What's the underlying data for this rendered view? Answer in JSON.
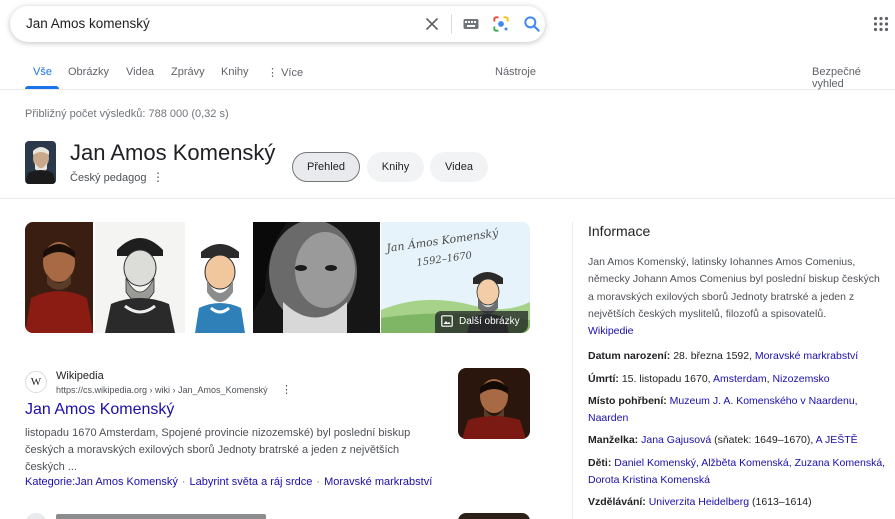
{
  "search": {
    "query": "Jan Amos komenský"
  },
  "tabs": {
    "items": [
      {
        "label": "Vše",
        "active": true
      },
      {
        "label": "Obrázky",
        "active": false
      },
      {
        "label": "Videa",
        "active": false
      },
      {
        "label": "Zprávy",
        "active": false
      },
      {
        "label": "Knihy",
        "active": false
      },
      {
        "label": "Více",
        "active": false
      }
    ],
    "tools": "Nástroje",
    "safesearch": "Bezpečné vyhled"
  },
  "stats": "Přibližný počet výsledků: 788 000 (0,32 s)",
  "entity": {
    "title": "Jan Amos Komenský",
    "subtitle": "Český pedagog",
    "chips": [
      "Přehled",
      "Knihy",
      "Videa"
    ]
  },
  "images": {
    "more_label": "Další obrázky",
    "handwritten": "Jan Ámos Komenský 1592–1670"
  },
  "result": {
    "favicon_letter": "W",
    "site_name": "Wikipedia",
    "url": "https://cs.wikipedia.org › wiki › Jan_Amos_Komenský",
    "title": "Jan Amos Komenský",
    "snippet_1": "listopadu 1670 Amsterdam, Spojené provincie nizozemské) byl poslední biskup",
    "snippet_2": "českých a moravských exilových sborů Jednoty bratrské a jeden z největších",
    "snippet_3": "českých ...",
    "links": [
      "Kategorie:Jan Amos Komenský",
      "Labyrint světa a ráj srdce",
      "Moravské markrabství"
    ]
  },
  "knowledge_panel": {
    "title": "Informace",
    "description": "Jan Amos Komenský, latinsky Iohannes Amos Comenius, německy Johann Amos Comenius byl poslední biskup českých a moravských exilových sborů Jednoty bratrské a jeden z největších českých myslitelů, filozofů a spisovatelů.",
    "source": "Wikipedie",
    "facts": {
      "born_label": "Datum narození:",
      "born_value": "28. března 1592,",
      "born_link": "Moravské markrabství",
      "died_label": "Úmrtí:",
      "died_value": "15. listopadu 1670,",
      "died_link_1": "Amsterdam",
      "died_sep": ",",
      "died_link_2": "Nizozemsko",
      "burial_label": "Místo pohřbení:",
      "burial_link": "Muzeum J. A. Komenského v Naardenu, Naarden",
      "spouse_label": "Manželka:",
      "spouse_link": "Jana Gajusová",
      "spouse_value": "(sňatek: 1649–1670),",
      "spouse_more": "A JEŠTĚ",
      "children_label": "Děti:",
      "children_links": "Daniel Komenský, Alžběta Komenská, Zuzana Komenská, Dorota Kristina Komenská",
      "education_label": "Vzdělávání:",
      "education_link": "Univerzita Heidelberg",
      "education_value": "(1613–1614)"
    }
  },
  "colors": {
    "link": "#1a0dab",
    "accent": "#1a73e8",
    "muted": "#4d5156"
  }
}
